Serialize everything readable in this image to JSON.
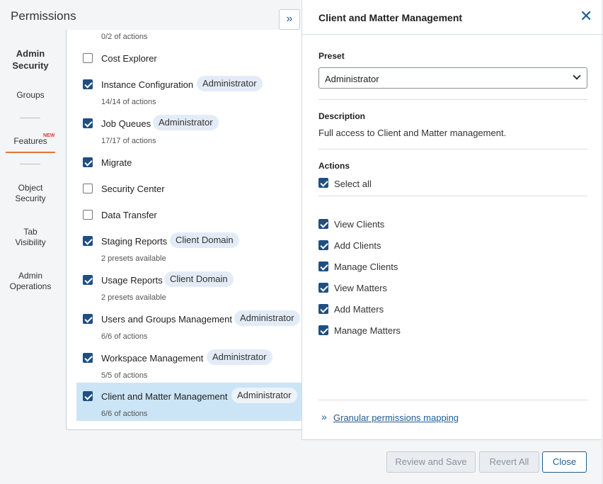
{
  "dialog": {
    "title": "Permissions"
  },
  "nav": {
    "admin_security": "Admin\nSecurity",
    "groups": "Groups",
    "features": "Features",
    "new_badge": "NEW",
    "object_security": "Object\nSecurity",
    "tab_visibility": "Tab\nVisibility",
    "admin_operations": "Admin\nOperations"
  },
  "features": {
    "top_sub": "0/2 of actions",
    "items": [
      {
        "label": "Cost Explorer",
        "checked": false,
        "badge": "",
        "sub": ""
      },
      {
        "label": "Instance Configuration",
        "checked": true,
        "badge": "Administrator",
        "sub": "14/14 of actions"
      },
      {
        "label": "Job Queues",
        "checked": true,
        "badge": "Administrator",
        "sub": "17/17 of actions"
      },
      {
        "label": "Migrate",
        "checked": true,
        "badge": "",
        "sub": ""
      },
      {
        "label": "Security Center",
        "checked": false,
        "badge": "",
        "sub": ""
      },
      {
        "label": "Data Transfer",
        "checked": false,
        "badge": "",
        "sub": ""
      },
      {
        "label": "Staging Reports",
        "checked": true,
        "badge": "Client Domain",
        "sub": "2 presets available"
      },
      {
        "label": "Usage Reports",
        "checked": true,
        "badge": "Client Domain",
        "sub": "2 presets available"
      },
      {
        "label": "Users and Groups Management",
        "checked": true,
        "badge": "Administrator",
        "sub": "6/6 of actions"
      },
      {
        "label": "Workspace Management",
        "checked": true,
        "badge": "Administrator",
        "sub": "5/5 of actions"
      },
      {
        "label": "Client and Matter Management",
        "checked": true,
        "badge": "Administrator",
        "sub": "6/6 of actions"
      }
    ]
  },
  "panel": {
    "title": "Client and Matter Management",
    "preset_label": "Preset",
    "preset_value": "Administrator",
    "description_label": "Description",
    "description": "Full access to Client and Matter management.",
    "actions_label": "Actions",
    "select_all": "Select all",
    "actions": [
      "View Clients",
      "Add Clients",
      "Manage Clients",
      "View Matters",
      "Add Matters",
      "Manage Matters"
    ],
    "link": "Granular permissions mapping"
  },
  "footer": {
    "review_save": "Review and Save",
    "revert_all": "Revert All",
    "close": "Close"
  },
  "colors": {
    "accent": "#1f5d94",
    "checkbox": "#1f4f82",
    "highlight": "#cbe5f6",
    "new": "#e23b2e",
    "active_tab": "#e8743b"
  }
}
